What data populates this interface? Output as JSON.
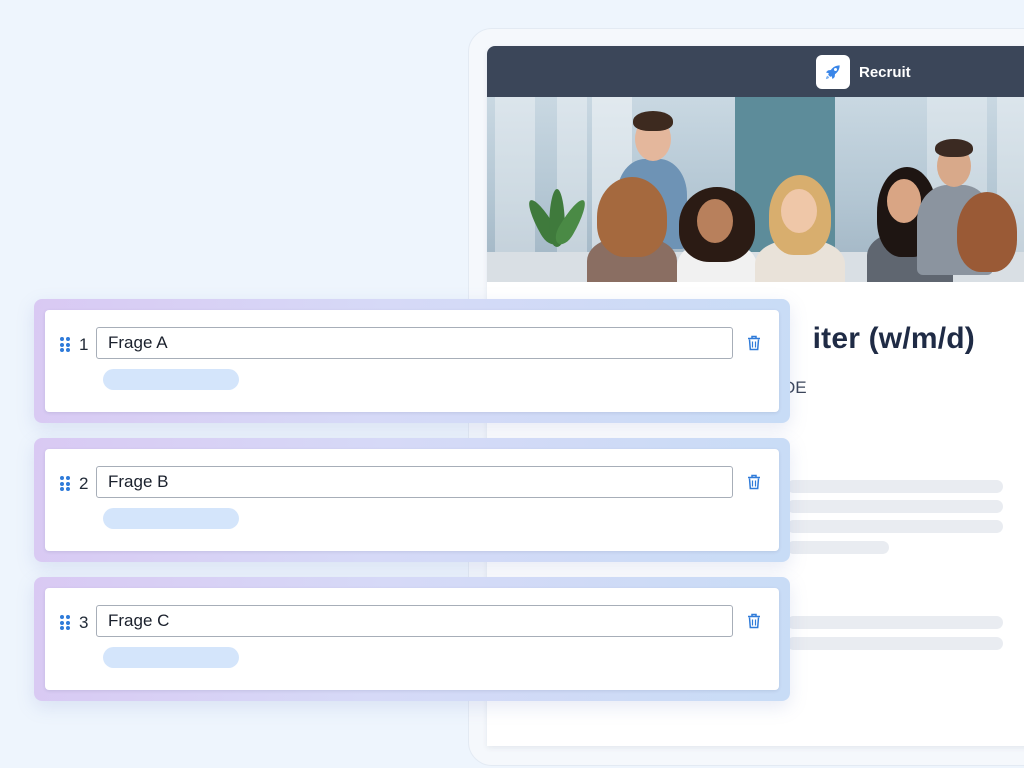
{
  "job_page": {
    "brand": {
      "name": "Recruit",
      "logo_icon": "rocket-icon"
    },
    "title_visible": "iter (w/m/d)",
    "location_visible": "DE"
  },
  "questions": [
    {
      "number": "1",
      "value": "Frage A"
    },
    {
      "number": "2",
      "value": "Frage B"
    },
    {
      "number": "3",
      "value": "Frage C"
    }
  ],
  "colors": {
    "accent": "#2f7bd9",
    "topbar": "#3b4659",
    "title": "#1f2b45",
    "card_gradient_start": "#d9c9f3",
    "card_gradient_end": "#c8dcf6"
  }
}
